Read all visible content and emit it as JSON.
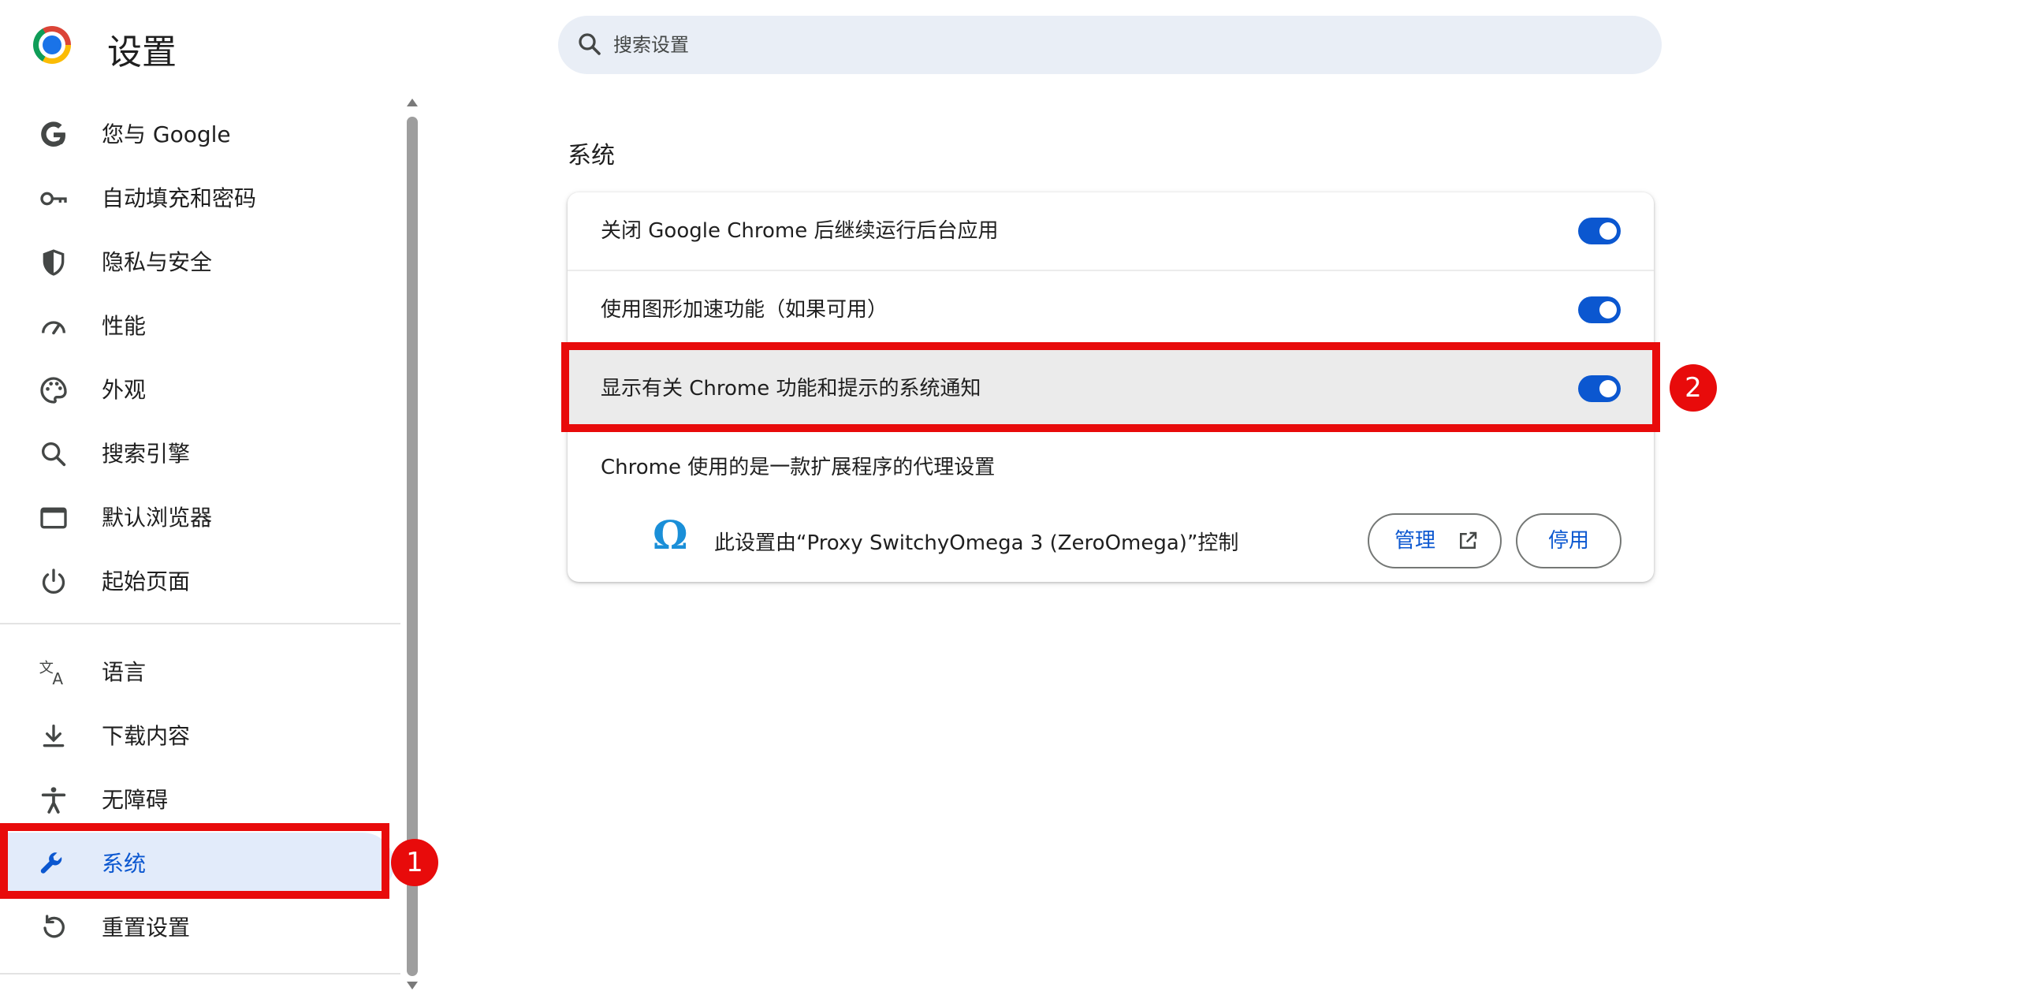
{
  "header": {
    "app_title": "设置",
    "search_placeholder": "搜索设置"
  },
  "sidebar": {
    "items": [
      {
        "label": "您与 Google",
        "icon": "google-g-icon"
      },
      {
        "label": "自动填充和密码",
        "icon": "key-icon"
      },
      {
        "label": "隐私与安全",
        "icon": "shield-icon"
      },
      {
        "label": "性能",
        "icon": "speedometer-icon"
      },
      {
        "label": "外观",
        "icon": "palette-icon"
      },
      {
        "label": "搜索引擎",
        "icon": "search-icon"
      },
      {
        "label": "默认浏览器",
        "icon": "browser-window-icon"
      },
      {
        "label": "起始页面",
        "icon": "power-icon"
      },
      {
        "label": "语言",
        "icon": "translate-icon"
      },
      {
        "label": "下载内容",
        "icon": "download-icon"
      },
      {
        "label": "无障碍",
        "icon": "accessibility-icon"
      },
      {
        "label": "系统",
        "icon": "wrench-icon",
        "active": true
      },
      {
        "label": "重置设置",
        "icon": "reset-icon"
      }
    ]
  },
  "annotations": {
    "badge_1": "1",
    "badge_2": "2",
    "color": "#e80b0b"
  },
  "main": {
    "section_title": "系统",
    "settings": [
      {
        "label": "关闭 Google Chrome 后继续运行后台应用",
        "enabled": true
      },
      {
        "label": "使用图形加速功能（如果可用）",
        "enabled": true
      },
      {
        "label": "显示有关 Chrome 功能和提示的系统通知",
        "enabled": true,
        "highlighted": true
      }
    ],
    "proxy": {
      "label": "Chrome 使用的是一款扩展程序的代理设置",
      "extension_text": "此设置由“Proxy SwitchyOmega 3 (ZeroOmega)”控制",
      "extension_icon": "omega-icon",
      "manage_label": "管理",
      "disable_label": "停用"
    }
  },
  "colors": {
    "accent": "#0b57d0",
    "active_nav_bg": "#e2ebfa",
    "search_bg": "#e9eef6"
  }
}
